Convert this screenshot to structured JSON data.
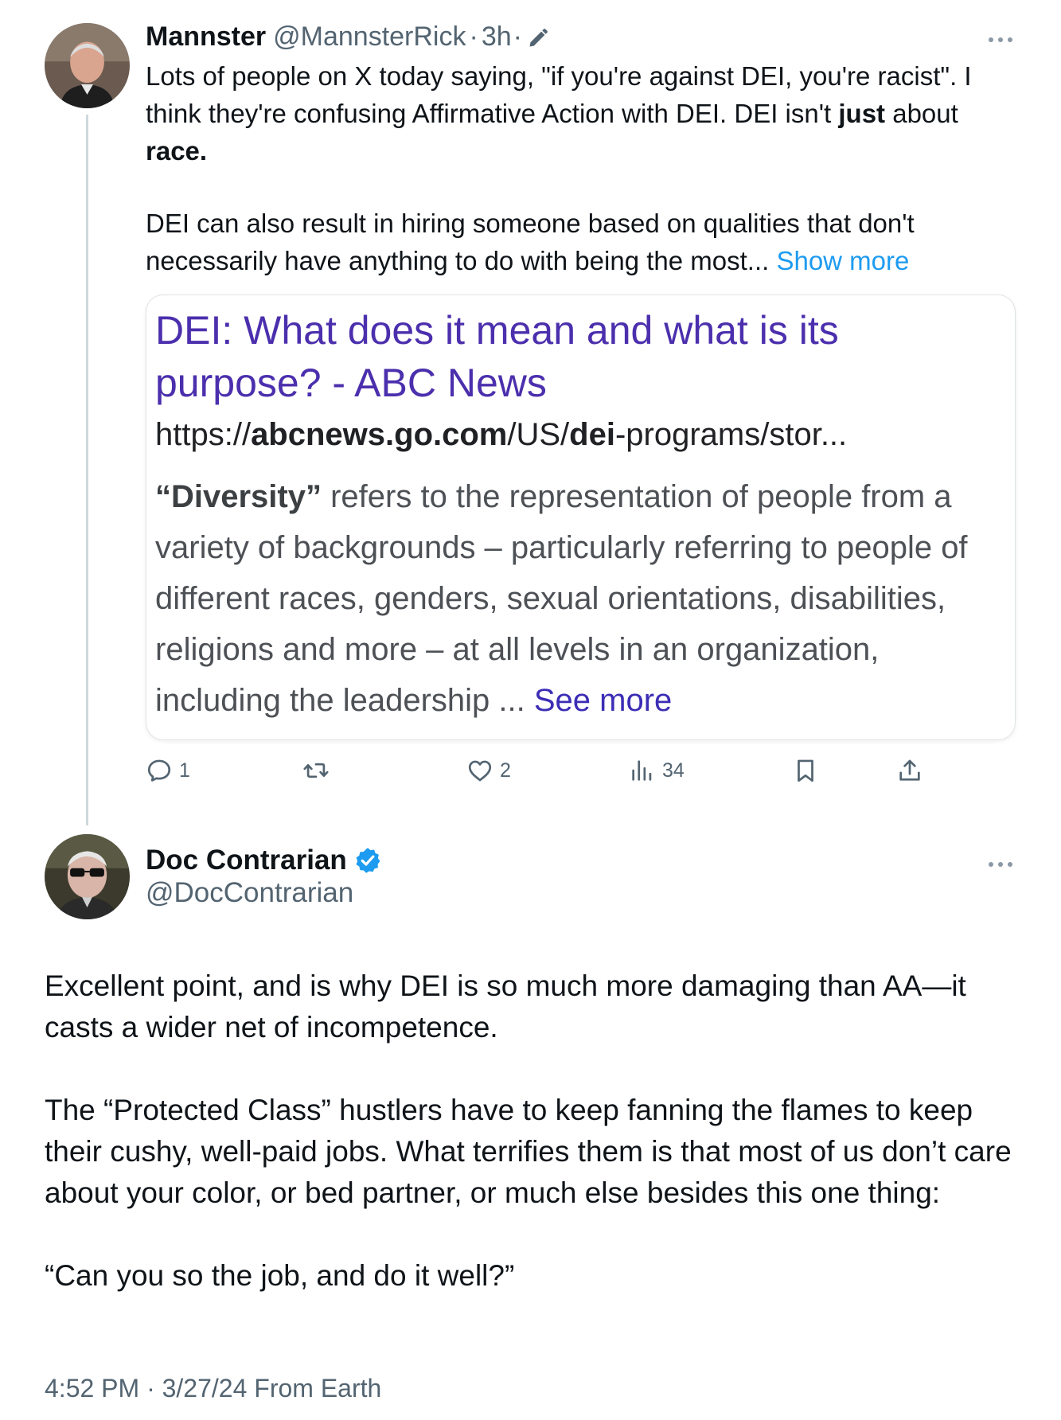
{
  "tweet1": {
    "author_name": "Mannster",
    "author_handle": "@MannsterRick",
    "dot1": "·",
    "time": "3h",
    "dot2": "·",
    "edited_icon": "pencil-edit-icon",
    "body": {
      "line1_plain": "Lots of people on X today saying, \"if you're against DEI, you're racist\".  I think they're confusing Affirmative Action with DEI.  DEI isn't ",
      "line1_bold": "just",
      "line1_after": " about ",
      "line1_bold2": "race.",
      "para2": "DEI can also result in hiring someone based on qualities that don't necessarily have anything to do with being the most...",
      "show_more": " Show more"
    },
    "card": {
      "title": "DEI: What does it mean and what is its purpose? - ABC News",
      "url_prefix": "https://",
      "url_domain": "abcnews.go.com",
      "url_mid": "/US/",
      "url_bold": "dei",
      "url_rest": "-programs/stor...",
      "snippet_bold": "“Diversity”",
      "snippet_text": " refers to the representation of people from a variety of backgrounds – particularly referring to people of different races, genders, sexual orientations, disabilities, religions and more – at all levels in an organization, including the leadership ...",
      "see_more": " See more"
    },
    "actions": {
      "replies": "1",
      "reposts": "",
      "likes": "2",
      "views": "34"
    }
  },
  "tweet2": {
    "author_name": "Doc Contrarian",
    "author_handle": "@DocContrarian",
    "para1": "Excellent point, and is why DEI is so much more damaging than AA—it casts a wider net of incompetence.",
    "para2": "The “Protected Class” hustlers have to keep fanning the flames to keep their cushy, well-paid jobs. What terrifies them is that most of us don’t care about your color, or bed partner, or much else besides this one thing:",
    "para3": "“Can you so the job, and do it well?”",
    "meta": "4:52 PM · 3/27/24 From Earth"
  },
  "colors": {
    "link_blue": "#1d9bf0",
    "card_title_purple": "#4b2fad",
    "secondary_text": "#536471",
    "verified_blue": "#1d9bf0"
  }
}
